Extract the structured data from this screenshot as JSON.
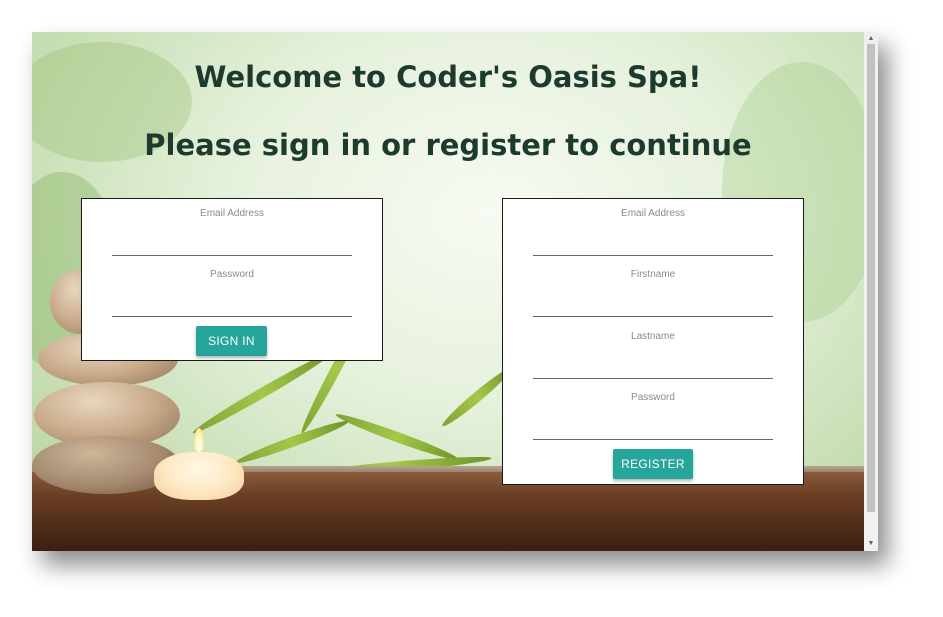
{
  "header": {
    "welcome": "Welcome to Coder's Oasis Spa!",
    "subtitle": "Please sign in or register to continue"
  },
  "signin": {
    "email_label": "Email Address",
    "email_value": "",
    "password_label": "Password",
    "password_value": "",
    "button_label": "SIGN IN"
  },
  "register": {
    "email_label": "Email Address",
    "email_value": "",
    "firstname_label": "Firstname",
    "firstname_value": "",
    "lastname_label": "Lastname",
    "lastname_value": "",
    "password_label": "Password",
    "password_value": "",
    "button_label": "REGISTER"
  },
  "colors": {
    "title": "#1d3a2f",
    "button": "#26a69a",
    "button_text": "#ffffff"
  },
  "icons": {
    "scroll_up": "scroll-up-arrow-icon",
    "scroll_down": "scroll-down-arrow-icon"
  }
}
